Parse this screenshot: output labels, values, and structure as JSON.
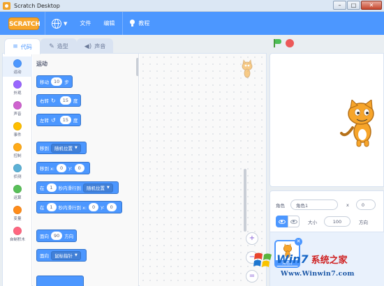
{
  "window": {
    "title": "Scratch Desktop",
    "controls": [
      "–",
      "□",
      "✕"
    ]
  },
  "menubar": {
    "logo_text": "SCRATCH",
    "items": {
      "file": "文件",
      "edit": "编辑",
      "tutorials": "教程"
    }
  },
  "tabs": {
    "code": "代码",
    "costumes": "造型",
    "sounds": "声音"
  },
  "categories": [
    {
      "label": "运动",
      "color": "#4c97ff"
    },
    {
      "label": "外观",
      "color": "#9966ff"
    },
    {
      "label": "声音",
      "color": "#cf63cf"
    },
    {
      "label": "事件",
      "color": "#ffbf00"
    },
    {
      "label": "控制",
      "color": "#ffab19"
    },
    {
      "label": "侦测",
      "color": "#5cb1d6"
    },
    {
      "label": "运算",
      "color": "#59c059"
    },
    {
      "label": "变量",
      "color": "#ff8c1a"
    },
    {
      "label": "自制积木",
      "color": "#ff6680"
    }
  ],
  "palette": {
    "section_title": "运动",
    "blocks": {
      "move": {
        "prefix": "移动",
        "value": "10",
        "suffix": "步"
      },
      "turn_right": {
        "prefix": "右转",
        "value": "15",
        "suffix": "度"
      },
      "turn_left": {
        "prefix": "左转",
        "value": "15",
        "suffix": "度"
      },
      "goto_random": {
        "prefix": "移到",
        "dropdown": "随机位置"
      },
      "goto_xy": {
        "prefix": "移到 x:",
        "x": "0",
        "ylabel": "y:",
        "y": "0"
      },
      "glide_random": {
        "prefix": "在",
        "secs": "1",
        "mid": "秒内滑行到",
        "dropdown": "随机位置"
      },
      "glide_xy": {
        "prefix": "在",
        "secs": "1",
        "mid": "秒内滑行到 x:",
        "x": "0",
        "ylabel": "y:",
        "y": "0"
      },
      "point_dir": {
        "prefix": "面向",
        "value": "90",
        "suffix": "方向"
      },
      "point_towards": {
        "prefix": "面向",
        "dropdown": "鼠标指针"
      }
    }
  },
  "sprite_info": {
    "sprite_label": "角色",
    "sprite_name": "角色1",
    "x_label": "x",
    "x_value": "0",
    "show_label": "显示",
    "size_label": "大小",
    "size_value": "100",
    "direction_label": "方向"
  },
  "sprite_list": [
    {
      "name": "角色1"
    }
  ],
  "watermark": {
    "brand": "Win7",
    "cn": "系统之家",
    "url": "Www.Winwin7.com"
  },
  "colors": {
    "menubar": "#4c97ff",
    "motion": "#4c97ff",
    "logo": "#f7a52a",
    "flag": "#4cbf56",
    "stop": "#ec5959"
  }
}
